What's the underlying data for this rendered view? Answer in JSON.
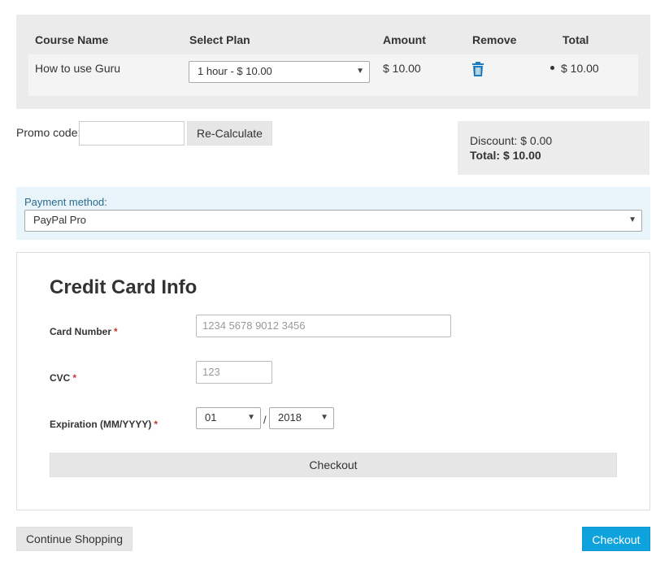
{
  "cart": {
    "headers": {
      "course_name": "Course Name",
      "select_plan": "Select Plan",
      "amount": "Amount",
      "remove": "Remove",
      "total": "Total"
    },
    "rows": [
      {
        "course_name": "How to use Guru",
        "plan": "1 hour - $ 10.00",
        "amount": "$ 10.00",
        "total": "$ 10.00"
      }
    ]
  },
  "promo": {
    "label": "Promo code:",
    "value": "",
    "recalculate_label": "Re-Calculate"
  },
  "summary": {
    "discount": "Discount: $ 0.00",
    "total": "Total: $ 10.00"
  },
  "payment": {
    "label": "Payment method:",
    "selected": "PayPal Pro"
  },
  "credit_card": {
    "title": "Credit Card Info",
    "required_mark": "*",
    "card_number_label": "Card Number",
    "card_number_placeholder": "1234 5678 9012 3456",
    "cvc_label": "CVC",
    "cvc_placeholder": "123",
    "expiration_label": "Expiration (MM/YYYY)",
    "exp_month": "01",
    "exp_separator": "/",
    "exp_year": "2018",
    "checkout_label": "Checkout"
  },
  "footer": {
    "continue_label": "Continue Shopping",
    "checkout_label": "Checkout"
  },
  "colors": {
    "accent": "#0fa3dd",
    "trash_icon": "#1a7dc4",
    "payment_bg": "#e9f5fb"
  }
}
